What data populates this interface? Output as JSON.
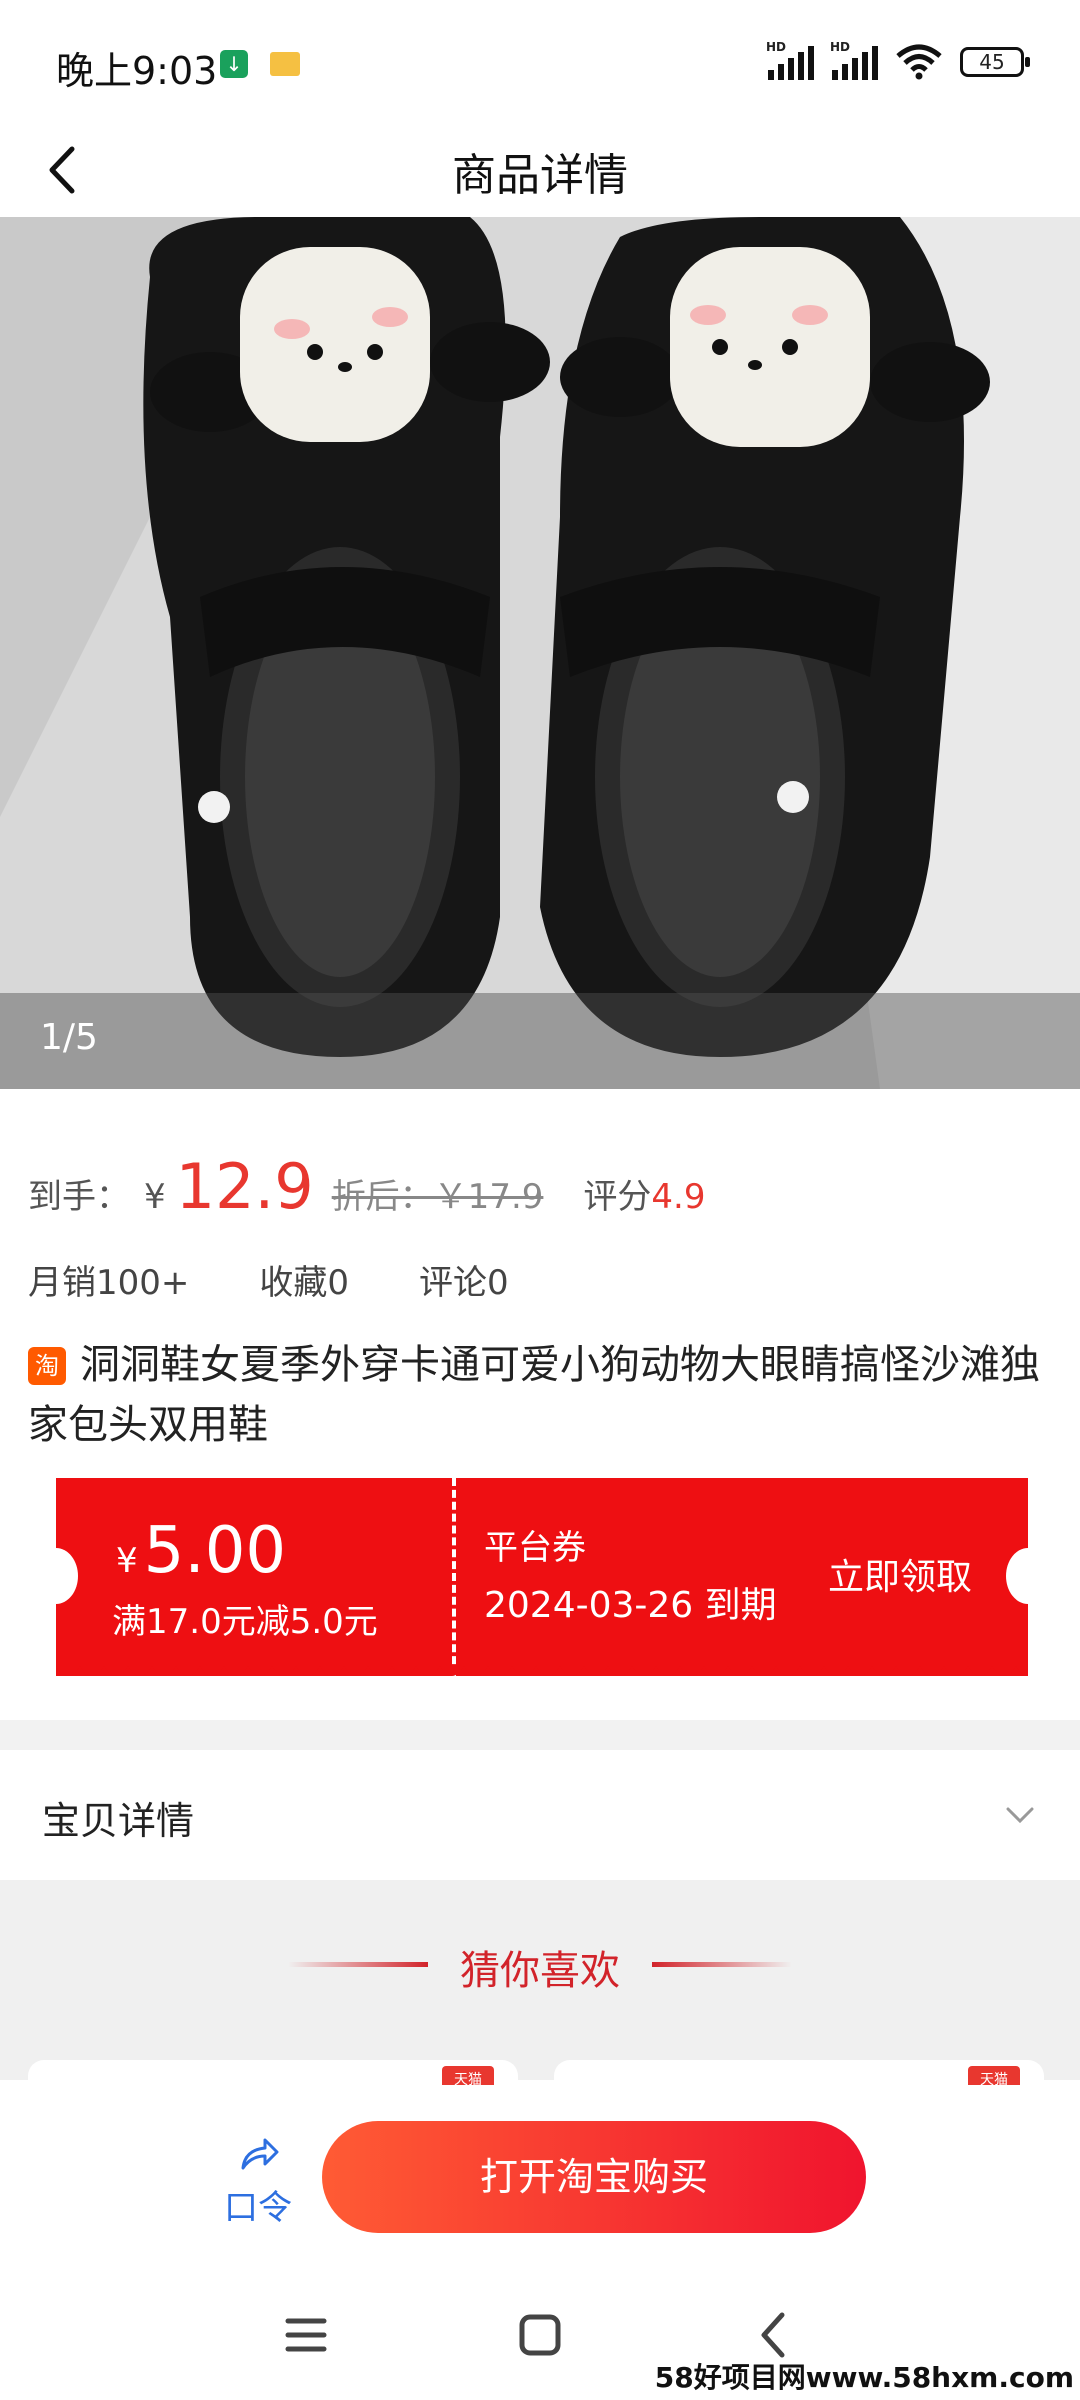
{
  "status_bar": {
    "time": "晚上9:03",
    "battery": "45"
  },
  "header": {
    "title": "商品详情"
  },
  "image": {
    "counter": "1/5"
  },
  "price": {
    "label": "到手：",
    "currency": "¥",
    "value": "12.9",
    "original": "折后：￥17.9",
    "rating_label": "评分",
    "rating_value": "4.9"
  },
  "stats": {
    "monthly_sales": "月销100+",
    "favorites": "收藏0",
    "comments": "评论0"
  },
  "product": {
    "badge": "淘",
    "title": "洞洞鞋女夏季外穿卡通可爱小狗动物大眼睛搞怪沙滩独家包头双用鞋"
  },
  "coupon": {
    "currency": "¥",
    "amount": "5.00",
    "condition": "满17.0元减5.0元",
    "type": "平台券",
    "expiry": "2024-03-26 到期",
    "action": "立即领取"
  },
  "detail": {
    "label": "宝贝详情"
  },
  "recommend": {
    "title": "猜你喜欢",
    "badge": "天猫"
  },
  "bottom": {
    "share_label": "口令",
    "buy_label": "打开淘宝购买"
  },
  "watermark": "58好项目网www.58hxm.com"
}
